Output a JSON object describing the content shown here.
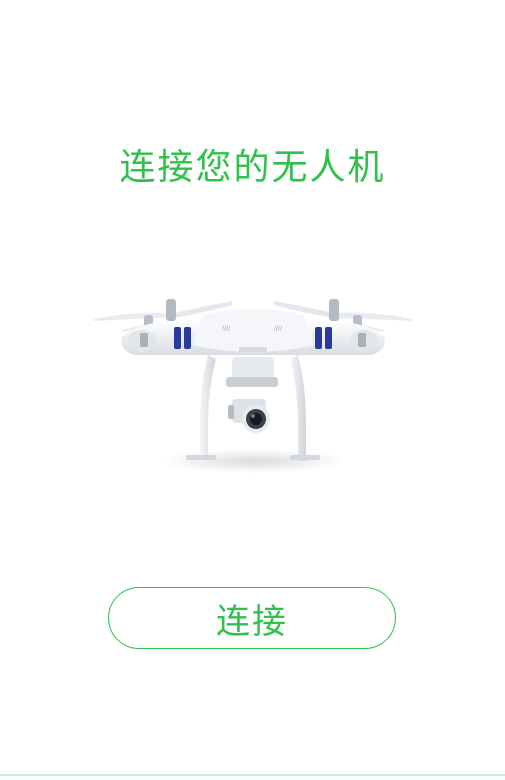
{
  "screen": {
    "title": "连接您的无人机",
    "connect_button_label": "连接",
    "accent_color": "#2ec24b"
  },
  "image": {
    "name": "quadcopter-drone",
    "icon": "drone-illustration"
  }
}
